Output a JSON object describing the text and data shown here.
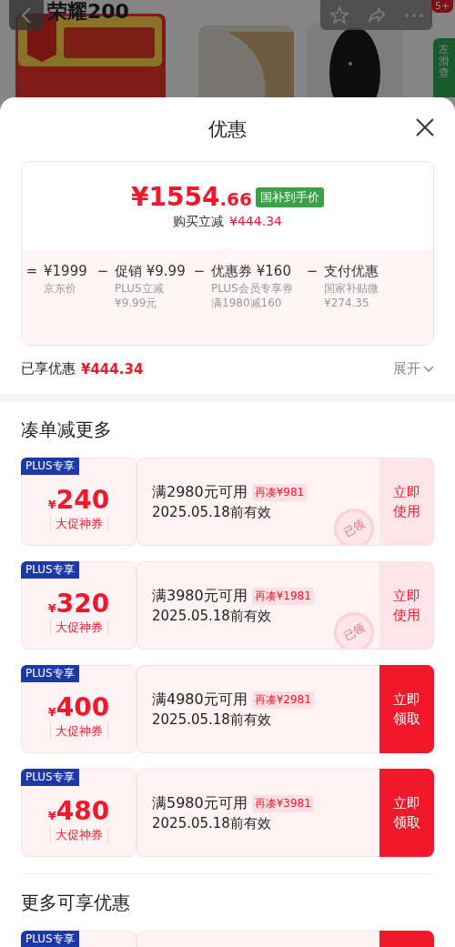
{
  "backdrop": {
    "title": "荣耀200",
    "cart_badge": "5+",
    "side_tab": "左滑查"
  },
  "sheet": {
    "title": "优惠"
  },
  "price_card": {
    "price": "¥1554",
    "price_decimal": ".66",
    "price_badge": "国补到手价",
    "saving_label": "购买立减",
    "saving_amount": "¥444.34",
    "breakdown": [
      {
        "op": "=",
        "amount": "¥1999",
        "lines": [
          "京东价"
        ]
      },
      {
        "op": "−",
        "amount": "促销 ¥9.99",
        "lines": [
          "PLUS立减",
          "¥9.99元"
        ]
      },
      {
        "op": "−",
        "amount": "优惠券 ¥160",
        "lines": [
          "PLUS会员专享券",
          "满1980减160"
        ]
      },
      {
        "op": "−",
        "amount": "支付优惠",
        "lines": [
          "国家补贴微",
          "¥274.35"
        ]
      }
    ]
  },
  "enjoyed": {
    "label": "已享优惠",
    "amount": "¥444.34",
    "toggle": "展开",
    "expanded": false
  },
  "sections": [
    {
      "title": "凑单减更多",
      "coupons": [
        {
          "tag": "PLUS专享",
          "currency": "¥",
          "amount": "240",
          "name": "大促神券",
          "condition": "满2980元可用",
          "gap": "再凑¥981",
          "validity": "2025.05.18前有效",
          "claimed": true,
          "stamp": "已领",
          "action": "立即使用"
        },
        {
          "tag": "PLUS专享",
          "currency": "¥",
          "amount": "320",
          "name": "大促神券",
          "condition": "满3980元可用",
          "gap": "再凑¥1981",
          "validity": "2025.05.18前有效",
          "claimed": true,
          "stamp": "已领",
          "action": "立即使用"
        },
        {
          "tag": "PLUS专享",
          "currency": "¥",
          "amount": "400",
          "name": "大促神券",
          "condition": "满4980元可用",
          "gap": "再凑¥2981",
          "validity": "2025.05.18前有效",
          "claimed": false,
          "action": "立即领取"
        },
        {
          "tag": "PLUS专享",
          "currency": "¥",
          "amount": "480",
          "name": "大促神券",
          "condition": "满5980元可用",
          "gap": "再凑¥3981",
          "validity": "2025.05.18前有效",
          "claimed": false,
          "action": "立即领取"
        }
      ]
    },
    {
      "title": "更多可享优惠",
      "coupons": [
        {
          "tag": "PLUS专享",
          "claimed": false
        }
      ]
    }
  ]
}
